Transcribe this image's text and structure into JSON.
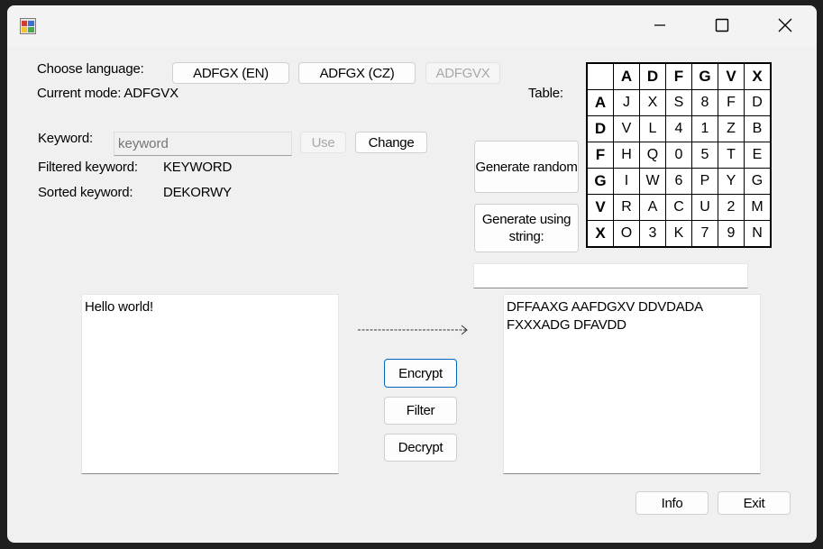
{
  "window": {
    "minimize_icon": "minimize-icon",
    "maximize_icon": "maximize-icon",
    "close_icon": "close-icon"
  },
  "language": {
    "label": "Choose language:",
    "buttons": [
      "ADFGX (EN)",
      "ADFGX (CZ)",
      "ADFGVX"
    ],
    "current_mode_label": "Current mode: ADFGVX"
  },
  "keyword": {
    "label": "Keyword:",
    "placeholder": "keyword",
    "use_button": "Use",
    "change_button": "Change",
    "filtered_label": "Filtered keyword:",
    "filtered_value": "KEYWORD",
    "sorted_label": "Sorted keyword:",
    "sorted_value": "DEKORWY"
  },
  "table": {
    "label": "Table:",
    "headers": [
      "A",
      "D",
      "F",
      "G",
      "V",
      "X"
    ],
    "rows": [
      [
        "J",
        "X",
        "S",
        "8",
        "F",
        "D"
      ],
      [
        "V",
        "L",
        "4",
        "1",
        "Z",
        "B"
      ],
      [
        "H",
        "Q",
        "0",
        "5",
        "T",
        "E"
      ],
      [
        "I",
        "W",
        "6",
        "P",
        "Y",
        "G"
      ],
      [
        "R",
        "A",
        "C",
        "U",
        "2",
        "M"
      ],
      [
        "O",
        "3",
        "K",
        "7",
        "9",
        "N"
      ]
    ],
    "generate_random_button": "Generate random",
    "generate_string_button": "Generate using string:",
    "string_input_value": ""
  },
  "io": {
    "input_text": "Hello world!",
    "output_text": "DFFAAXG AAFDGXV DDVDADA FXXXADG DFAVDD",
    "arrow": "------------------------->"
  },
  "actions": {
    "encrypt": "Encrypt",
    "filter": "Filter",
    "decrypt": "Decrypt",
    "info": "Info",
    "exit": "Exit"
  }
}
